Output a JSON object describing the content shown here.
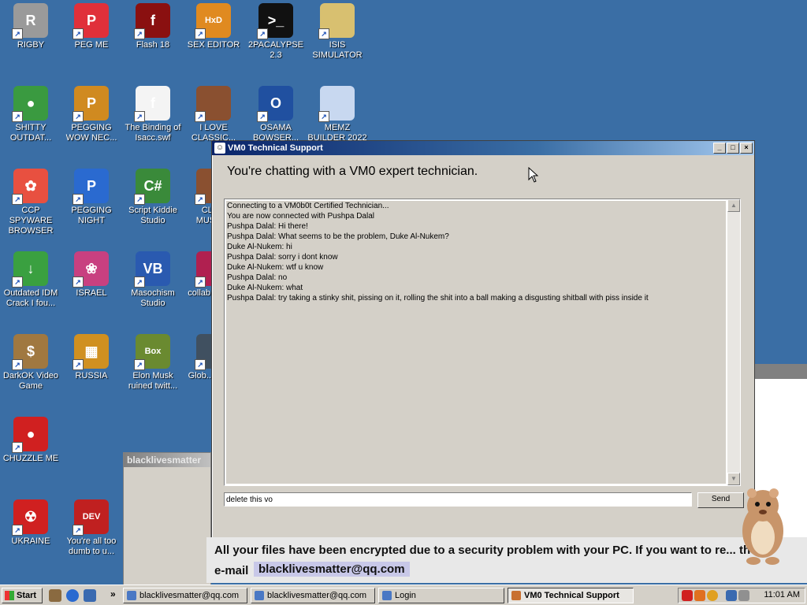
{
  "desktop_icons": [
    {
      "label": "RIGBY",
      "icon": "raccoon-icon",
      "color": "#9a9a9a",
      "glyph": "R"
    },
    {
      "label": "PEG ME",
      "icon": "peggle-icon",
      "color": "#e0303a",
      "glyph": "P"
    },
    {
      "label": "Flash 18",
      "icon": "flash-icon",
      "color": "#8a1010",
      "glyph": "f"
    },
    {
      "label": "SEX EDITOR",
      "icon": "hxd-icon",
      "color": "#e08a20",
      "glyph": "HxD"
    },
    {
      "label": "2PACALYPSE 2.3",
      "icon": "console-icon",
      "color": "#111111",
      "glyph": ">_"
    },
    {
      "label": "ISIS SIMULATOR",
      "icon": "folder-icon",
      "color": "#d8c070",
      "glyph": ""
    },
    {
      "label": "SHITTY OUTDAT...",
      "icon": "chrome-icon",
      "color": "#3a9a40",
      "glyph": "●"
    },
    {
      "label": "PEGGING WOW NEC...",
      "icon": "peggle-icon",
      "color": "#d08a20",
      "glyph": "P"
    },
    {
      "label": "The Binding of Isacc.swf",
      "icon": "flash-file-icon",
      "color": "#f4f4f4",
      "glyph": "f"
    },
    {
      "label": "I LOVE CLASSIC...",
      "icon": "portrait-icon",
      "color": "#8a5030",
      "glyph": ""
    },
    {
      "label": "OSAMA BOWSER...",
      "icon": "obama-logo-icon",
      "color": "#2050a0",
      "glyph": "O"
    },
    {
      "label": "MEMZ BUILDER 2022",
      "icon": "window-icon",
      "color": "#c8d8f0",
      "glyph": ""
    },
    {
      "label": "CCP SPYWARE BROWSER",
      "icon": "pinwheel-icon",
      "color": "#e85040",
      "glyph": "✿"
    },
    {
      "label": "PEGGING NIGHT",
      "icon": "peggle-icon",
      "color": "#2a6ad0",
      "glyph": "P"
    },
    {
      "label": "Script Kiddie Studio",
      "icon": "csharp-icon",
      "color": "#3a8a3a",
      "glyph": "C#"
    },
    {
      "label": "CLA... MUSIC...",
      "icon": "portrait-icon",
      "color": "#8a5030",
      "glyph": ""
    },
    {
      "label": "Outdated IDM Crack I fou...",
      "icon": "idm-icon",
      "color": "#3aa040",
      "glyph": "↓"
    },
    {
      "label": "ISRAEL",
      "icon": "flower-icon",
      "color": "#c84080",
      "glyph": "❀"
    },
    {
      "label": "Masochism Studio",
      "icon": "vb-icon",
      "color": "#2a5ab0",
      "glyph": "VB"
    },
    {
      "label": "collab... too...",
      "icon": "film-icon",
      "color": "#b02050",
      "glyph": ""
    },
    {
      "label": "DarkOK Video Game",
      "icon": "money-bag-icon",
      "color": "#a07840",
      "glyph": "$"
    },
    {
      "label": "RUSSIA",
      "icon": "blocks-icon",
      "color": "#d09020",
      "glyph": "▦"
    },
    {
      "label": "Elon Musk ruined twitt...",
      "icon": "bonzi-box-icon",
      "color": "#6a8a30",
      "glyph": "Box"
    },
    {
      "label": "Glob... Ran...",
      "icon": "globe-icon",
      "color": "#405060",
      "glyph": ""
    },
    {
      "label": "CHUZZLE ME",
      "icon": "chuzzle-icon",
      "color": "#d02020",
      "glyph": "●"
    },
    {
      "label": "UKRAINE",
      "icon": "radiation-icon",
      "color": "#d02020",
      "glyph": "☢"
    },
    {
      "label": "You're all too dumb to u...",
      "icon": "devcpp-icon",
      "color": "#c02020",
      "glyph": "DEV"
    }
  ],
  "bg_window": {
    "title": "blacklivesmatter"
  },
  "chat": {
    "title": "VM0 Technical Support",
    "heading": "You're chatting with a VM0 expert technician.",
    "log": [
      "Connecting to a VM0b0t Certified Technician...",
      "You are now connected with Pushpa Dalal",
      "Pushpa Dalal: Hi there!",
      "Pushpa Dalal: What seems to be the problem, Duke Al-Nukem?",
      "Duke Al-Nukem: hi",
      "Pushpa Dalal: sorry i dont know",
      "Duke Al-Nukem: wtf u know",
      "Pushpa Dalal: no",
      "Duke Al-Nukem: what",
      "Pushpa Dalal: try taking a stinky shit, pissing on it, rolling the shit into a ball making a disgusting shitball with piss inside it"
    ],
    "input_value": "delete this vo",
    "send_label": "Send"
  },
  "ransom": {
    "message": "All your files have been encrypted due to a security problem with your PC. If you want to re... them",
    "email_label": "e-mail",
    "email": "blacklivesmatter@qq.com"
  },
  "taskbar": {
    "start_label": "Start",
    "tasks": [
      {
        "label": "blacklivesmatter@qq.com",
        "active": false
      },
      {
        "label": "blacklivesmatter@qq.com",
        "active": false
      },
      {
        "label": "Login",
        "active": false
      },
      {
        "label": "VM0 Technical Support",
        "active": true
      }
    ],
    "overflow_label": "»",
    "clock": "11:01 AM"
  }
}
